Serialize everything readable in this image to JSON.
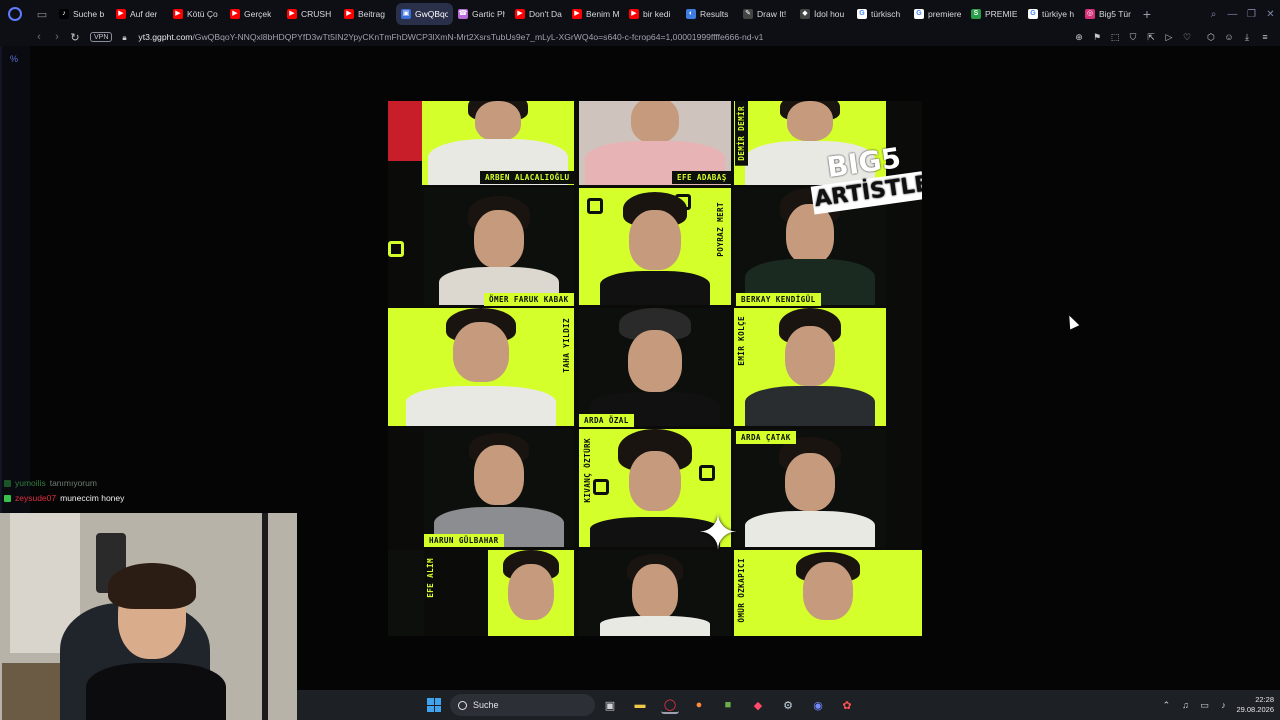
{
  "browser": {
    "tabs": [
      {
        "label": "Suche b",
        "fav_color": "#000000",
        "fav_glyph": "♪"
      },
      {
        "label": "Auf der",
        "fav_color": "#ff0000",
        "fav_glyph": "▶"
      },
      {
        "label": "Kötü Ço",
        "fav_color": "#ff0000",
        "fav_glyph": "▶"
      },
      {
        "label": "Gerçek",
        "fav_color": "#ff0000",
        "fav_glyph": "▶"
      },
      {
        "label": "CRUSH",
        "fav_color": "#ff0000",
        "fav_glyph": "▶"
      },
      {
        "label": "Beitrag",
        "fav_color": "#ff0000",
        "fav_glyph": "▶"
      },
      {
        "label": "GwQBqoY-NNQ",
        "fav_color": "#3a6fd8",
        "fav_glyph": "▣"
      },
      {
        "label": "Gartic Ph",
        "fav_color": "#b86bd8",
        "fav_glyph": "☎"
      },
      {
        "label": "Don't Da",
        "fav_color": "#ff0000",
        "fav_glyph": "▶"
      },
      {
        "label": "Benim M",
        "fav_color": "#ff0000",
        "fav_glyph": "▶"
      },
      {
        "label": "bir kedi",
        "fav_color": "#ff0000",
        "fav_glyph": "▶"
      },
      {
        "label": "Results",
        "fav_color": "#3d7ce0",
        "fav_glyph": "◐"
      },
      {
        "label": "Draw It!",
        "fav_color": "#444444",
        "fav_glyph": "✎"
      },
      {
        "label": "İdol hou",
        "fav_color": "#444444",
        "fav_glyph": "◆"
      },
      {
        "label": "türkisch",
        "fav_color": "#ffffff",
        "fav_glyph": "G"
      },
      {
        "label": "premiere",
        "fav_color": "#ffffff",
        "fav_glyph": "G"
      },
      {
        "label": "PREMIER",
        "fav_color": "#2a9d4a",
        "fav_glyph": "S"
      },
      {
        "label": "türkiye h",
        "fav_color": "#ffffff",
        "fav_glyph": "G"
      },
      {
        "label": "Big5 Tür",
        "fav_color": "#d6307a",
        "fav_glyph": "◎"
      }
    ],
    "active_tab_index": 6,
    "new_tab_label": "+",
    "vpn_label": "VPN",
    "url_host": "yt3.ggpht.com",
    "url_path": "/GwQBqoY-NNQxl8bHDQPYfD3wTt5IN2YpyCKnTmFhDWCP3lXmN-Mrt2XsrsTubUs9e7_mLyL-XGrWQ4o=s640-c-fcrop64=1,00001999ffffe666-nd-v1"
  },
  "sidebar": {
    "tick": "%"
  },
  "poster": {
    "heading_line1": "BIG5",
    "heading_line2": "ARTİSTLERİ",
    "names": {
      "arben": "ARBEN ALACALIOĞLU",
      "efe_adabas": "EFE ADABAŞ",
      "demir": "DEMİR DEMİR",
      "omer": "ÖMER FARUK KABAK",
      "poyraz": "POYRAZ MERT",
      "berkay": "BERKAY KENDİGÜL",
      "taha": "TAHA YILDIZ",
      "arda_ozal": "ARDA ÖZAL",
      "emir": "EMİR KOLÇE",
      "arda_catak": "ARDA ÇATAK",
      "kivanc": "KIVANÇ ÖZTÜRK",
      "harun": "HARUN GÜLBAHAR",
      "efe_alim": "EFE ALİM",
      "omur": "ÖMÜR ÖZKAPICI"
    }
  },
  "chat": {
    "messages": [
      {
        "user": "yumoilis",
        "text": "tanımıyorum"
      },
      {
        "user": "zeysude07",
        "text": "muneccim honey"
      }
    ]
  },
  "taskbar": {
    "search_label": "Suche",
    "time": "22:28",
    "date": "29.08.2026"
  },
  "colors": {
    "poster_accent": "#d4ff2a",
    "active_tab": "#2a2f4a",
    "opera_accent": "#5f7bff"
  }
}
